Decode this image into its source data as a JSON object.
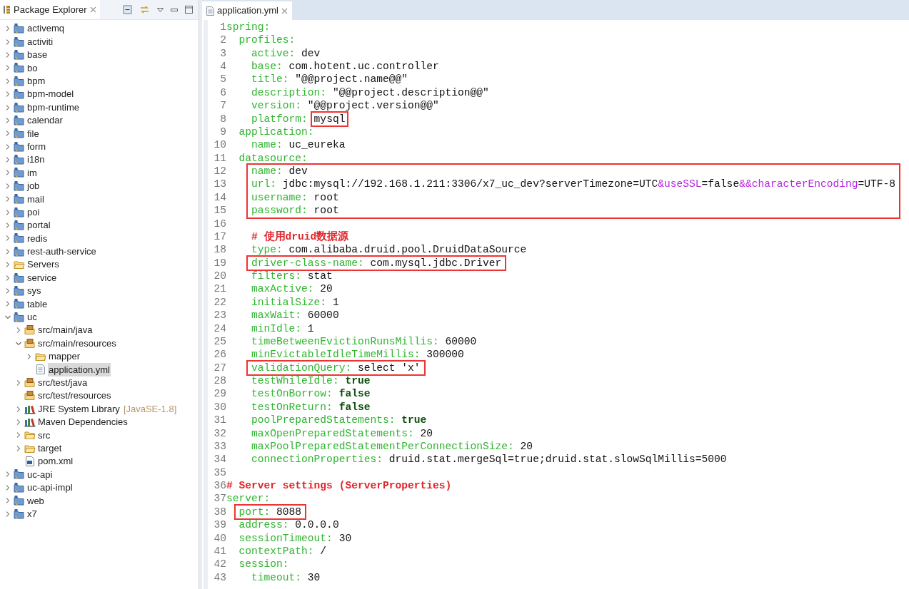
{
  "explorer": {
    "title": "Package Explorer",
    "items": [
      {
        "label": "activemq",
        "kind": "project",
        "expanded": false,
        "selected": false
      },
      {
        "label": "activiti",
        "kind": "project",
        "expanded": false,
        "selected": false
      },
      {
        "label": "base",
        "kind": "project",
        "expanded": false,
        "selected": false
      },
      {
        "label": "bo",
        "kind": "project",
        "expanded": false,
        "selected": false
      },
      {
        "label": "bpm",
        "kind": "project",
        "expanded": false,
        "selected": false
      },
      {
        "label": "bpm-model",
        "kind": "project",
        "expanded": false,
        "selected": false
      },
      {
        "label": "bpm-runtime",
        "kind": "project",
        "expanded": false,
        "selected": false
      },
      {
        "label": "calendar",
        "kind": "project",
        "expanded": false,
        "selected": false
      },
      {
        "label": "file",
        "kind": "project",
        "expanded": false,
        "selected": false
      },
      {
        "label": "form",
        "kind": "project",
        "expanded": false,
        "selected": false
      },
      {
        "label": "i18n",
        "kind": "project",
        "expanded": false,
        "selected": false
      },
      {
        "label": "im",
        "kind": "project",
        "expanded": false,
        "selected": false
      },
      {
        "label": "job",
        "kind": "project",
        "expanded": false,
        "selected": false
      },
      {
        "label": "mail",
        "kind": "project",
        "expanded": false,
        "selected": false
      },
      {
        "label": "poi",
        "kind": "project",
        "expanded": false,
        "selected": false
      },
      {
        "label": "portal",
        "kind": "project",
        "expanded": false,
        "selected": false
      },
      {
        "label": "redis",
        "kind": "project",
        "expanded": false,
        "selected": false
      },
      {
        "label": "rest-auth-service",
        "kind": "project",
        "expanded": false,
        "selected": false
      },
      {
        "label": "Servers",
        "kind": "folder",
        "expanded": false,
        "selected": false
      },
      {
        "label": "service",
        "kind": "project",
        "expanded": false,
        "selected": false
      },
      {
        "label": "sys",
        "kind": "project",
        "expanded": false,
        "selected": false
      },
      {
        "label": "table",
        "kind": "project",
        "expanded": false,
        "selected": false
      },
      {
        "label": "uc",
        "kind": "project",
        "expanded": true,
        "selected": false,
        "children": [
          {
            "label": "src/main/java",
            "kind": "source-folder",
            "expanded": false,
            "selected": false
          },
          {
            "label": "src/main/resources",
            "kind": "source-folder",
            "expanded": true,
            "selected": false,
            "children": [
              {
                "label": "mapper",
                "kind": "folder",
                "expanded": false,
                "selected": false
              },
              {
                "label": "application.yml",
                "kind": "text-file",
                "selected": true
              }
            ]
          },
          {
            "label": "src/test/java",
            "kind": "source-folder",
            "expanded": false,
            "selected": false
          },
          {
            "label": "src/test/resources",
            "kind": "source-folder",
            "selected": false
          },
          {
            "label": "JRE System Library",
            "decoration": "[JavaSE-1.8]",
            "kind": "library",
            "expanded": false,
            "selected": false
          },
          {
            "label": "Maven Dependencies",
            "kind": "library",
            "expanded": false,
            "selected": false
          },
          {
            "label": "src",
            "kind": "folder",
            "expanded": false,
            "selected": false
          },
          {
            "label": "target",
            "kind": "folder",
            "expanded": false,
            "selected": false
          },
          {
            "label": "pom.xml",
            "kind": "xml-file",
            "selected": false
          }
        ]
      },
      {
        "label": "uc-api",
        "kind": "project",
        "expanded": false,
        "selected": false
      },
      {
        "label": "uc-api-impl",
        "kind": "project",
        "expanded": false,
        "selected": false
      },
      {
        "label": "web",
        "kind": "project",
        "expanded": false,
        "selected": false
      },
      {
        "label": "x7",
        "kind": "project",
        "expanded": false,
        "selected": false
      }
    ]
  },
  "editor": {
    "tab": "application.yml",
    "lines": [
      {
        "number": "1",
        "boxed": false,
        "segments": [
          {
            "kind": "key",
            "text": "spring:"
          }
        ]
      },
      {
        "number": "2",
        "boxed": false,
        "segments": [
          {
            "kind": "key",
            "text": "  profiles:"
          }
        ]
      },
      {
        "number": "3",
        "boxed": false,
        "segments": [
          {
            "kind": "key",
            "text": "    active:"
          },
          {
            "kind": "plain",
            "text": " dev"
          }
        ]
      },
      {
        "number": "4",
        "boxed": false,
        "segments": [
          {
            "kind": "key",
            "text": "    base:"
          },
          {
            "kind": "plain",
            "text": " com.hotent.uc.controller"
          }
        ]
      },
      {
        "number": "5",
        "boxed": false,
        "segments": [
          {
            "kind": "key",
            "text": "    title:"
          },
          {
            "kind": "plain",
            "text": " \"@@project.name@@\""
          }
        ]
      },
      {
        "number": "6",
        "boxed": false,
        "segments": [
          {
            "kind": "key",
            "text": "    description:"
          },
          {
            "kind": "plain",
            "text": " \"@@project.description@@\""
          }
        ]
      },
      {
        "number": "7",
        "boxed": false,
        "segments": [
          {
            "kind": "key",
            "text": "    version:"
          },
          {
            "kind": "plain",
            "text": " \"@@project.version@@\""
          }
        ]
      },
      {
        "number": "8",
        "boxed": true,
        "box_from_value": true,
        "segments": [
          {
            "kind": "key",
            "text": "    platform:"
          },
          {
            "kind": "plain",
            "text": " mysql"
          }
        ]
      },
      {
        "number": "9",
        "boxed": false,
        "segments": [
          {
            "kind": "key",
            "text": "  application:"
          }
        ]
      },
      {
        "number": "10",
        "boxed": false,
        "segments": [
          {
            "kind": "key",
            "text": "    name:"
          },
          {
            "kind": "plain",
            "text": " uc_eureka"
          }
        ]
      },
      {
        "number": "11",
        "boxed": false,
        "segments": [
          {
            "kind": "key",
            "text": "  datasource:"
          }
        ]
      },
      {
        "number": "12",
        "boxed": true,
        "segments": [
          {
            "kind": "key",
            "text": "    name:"
          },
          {
            "kind": "plain",
            "text": " dev"
          }
        ]
      },
      {
        "number": "13",
        "boxed": true,
        "segments": [
          {
            "kind": "key",
            "text": "    url:"
          },
          {
            "kind": "plain",
            "text": " jdbc:mysql://192.168.1.211:3306/x7_uc_dev?serverTimezone=UTC"
          },
          {
            "kind": "param",
            "text": "&useSSL"
          },
          {
            "kind": "plain",
            "text": "=false"
          },
          {
            "kind": "param",
            "text": "&&characterEncoding"
          },
          {
            "kind": "plain",
            "text": "=UTF-8"
          }
        ]
      },
      {
        "number": "14",
        "boxed": true,
        "segments": [
          {
            "kind": "key",
            "text": "    username:"
          },
          {
            "kind": "plain",
            "text": " root"
          }
        ]
      },
      {
        "number": "15",
        "boxed": true,
        "segments": [
          {
            "kind": "key",
            "text": "    password:"
          },
          {
            "kind": "plain",
            "text": " root"
          }
        ]
      },
      {
        "number": "16",
        "boxed": false
      },
      {
        "number": "17",
        "boxed": false,
        "segments": [
          {
            "kind": "comment",
            "text": "    # 使用druid数据源"
          }
        ]
      },
      {
        "number": "18",
        "boxed": false,
        "segments": [
          {
            "kind": "key",
            "text": "    type:"
          },
          {
            "kind": "plain",
            "text": " com.alibaba.druid.pool.DruidDataSource"
          }
        ]
      },
      {
        "number": "19",
        "boxed": true,
        "segments": [
          {
            "kind": "key",
            "text": "    driver-class-name:"
          },
          {
            "kind": "plain",
            "text": " com.mysql.jdbc.Driver"
          }
        ]
      },
      {
        "number": "20",
        "boxed": false,
        "segments": [
          {
            "kind": "key",
            "text": "    filters:"
          },
          {
            "kind": "plain",
            "text": " stat"
          }
        ]
      },
      {
        "number": "21",
        "boxed": false,
        "segments": [
          {
            "kind": "key",
            "text": "    maxActive:"
          },
          {
            "kind": "plain",
            "text": " 20"
          }
        ]
      },
      {
        "number": "22",
        "boxed": false,
        "segments": [
          {
            "kind": "key",
            "text": "    initialSize:"
          },
          {
            "kind": "plain",
            "text": " 1"
          }
        ]
      },
      {
        "number": "23",
        "boxed": false,
        "segments": [
          {
            "kind": "key",
            "text": "    maxWait:"
          },
          {
            "kind": "plain",
            "text": " 60000"
          }
        ]
      },
      {
        "number": "24",
        "boxed": false,
        "segments": [
          {
            "kind": "key",
            "text": "    minIdle:"
          },
          {
            "kind": "plain",
            "text": " 1"
          }
        ]
      },
      {
        "number": "25",
        "boxed": false,
        "segments": [
          {
            "kind": "key",
            "text": "    timeBetweenEvictionRunsMillis:"
          },
          {
            "kind": "plain",
            "text": " 60000"
          }
        ]
      },
      {
        "number": "26",
        "boxed": false,
        "segments": [
          {
            "kind": "key",
            "text": "    minEvictableIdleTimeMillis:"
          },
          {
            "kind": "plain",
            "text": " 300000"
          }
        ]
      },
      {
        "number": "27",
        "boxed": true,
        "segments": [
          {
            "kind": "key",
            "text": "    validationQuery:"
          },
          {
            "kind": "plain",
            "text": " select 'x'"
          }
        ]
      },
      {
        "number": "28",
        "boxed": false,
        "segments": [
          {
            "kind": "key",
            "text": "    testWhileIdle:"
          },
          {
            "kind": "keyword",
            "text": " true"
          }
        ]
      },
      {
        "number": "29",
        "boxed": false,
        "segments": [
          {
            "kind": "key",
            "text": "    testOnBorrow:"
          },
          {
            "kind": "keyword",
            "text": " false"
          }
        ]
      },
      {
        "number": "30",
        "boxed": false,
        "segments": [
          {
            "kind": "key",
            "text": "    testOnReturn:"
          },
          {
            "kind": "keyword",
            "text": " false"
          }
        ]
      },
      {
        "number": "31",
        "boxed": false,
        "segments": [
          {
            "kind": "key",
            "text": "    poolPreparedStatements:"
          },
          {
            "kind": "keyword",
            "text": " true"
          }
        ]
      },
      {
        "number": "32",
        "boxed": false,
        "segments": [
          {
            "kind": "key",
            "text": "    maxOpenPreparedStatements:"
          },
          {
            "kind": "plain",
            "text": " 20"
          }
        ]
      },
      {
        "number": "33",
        "boxed": false,
        "segments": [
          {
            "kind": "key",
            "text": "    maxPoolPreparedStatementPerConnectionSize:"
          },
          {
            "kind": "plain",
            "text": " 20"
          }
        ]
      },
      {
        "number": "34",
        "boxed": false,
        "segments": [
          {
            "kind": "key",
            "text": "    connectionProperties:"
          },
          {
            "kind": "plain",
            "text": " druid.stat.mergeSql=true;druid.stat.slowSqlMillis=5000"
          }
        ]
      },
      {
        "number": "35",
        "boxed": false
      },
      {
        "number": "36",
        "boxed": false,
        "segments": [
          {
            "kind": "comment",
            "text": "# Server settings (ServerProperties)"
          }
        ]
      },
      {
        "number": "37",
        "boxed": false,
        "segments": [
          {
            "kind": "key",
            "text": "server:"
          }
        ]
      },
      {
        "number": "38",
        "boxed": true,
        "segments": [
          {
            "kind": "key",
            "text": "  port:"
          },
          {
            "kind": "plain",
            "text": " 8088"
          }
        ]
      },
      {
        "number": "39",
        "boxed": false,
        "segments": [
          {
            "kind": "key",
            "text": "  address:"
          },
          {
            "kind": "plain",
            "text": " 0.0.0.0"
          }
        ]
      },
      {
        "number": "40",
        "boxed": false,
        "segments": [
          {
            "kind": "key",
            "text": "  sessionTimeout:"
          },
          {
            "kind": "plain",
            "text": " 30"
          }
        ]
      },
      {
        "number": "41",
        "boxed": false,
        "segments": [
          {
            "kind": "key",
            "text": "  contextPath:"
          },
          {
            "kind": "plain",
            "text": " /"
          }
        ]
      },
      {
        "number": "42",
        "boxed": false,
        "segments": [
          {
            "kind": "key",
            "text": "  session:"
          }
        ]
      },
      {
        "number": "43",
        "boxed": false,
        "segments": [
          {
            "kind": "key",
            "text": "    timeout:"
          },
          {
            "kind": "plain",
            "text": " 30"
          }
        ]
      }
    ]
  }
}
